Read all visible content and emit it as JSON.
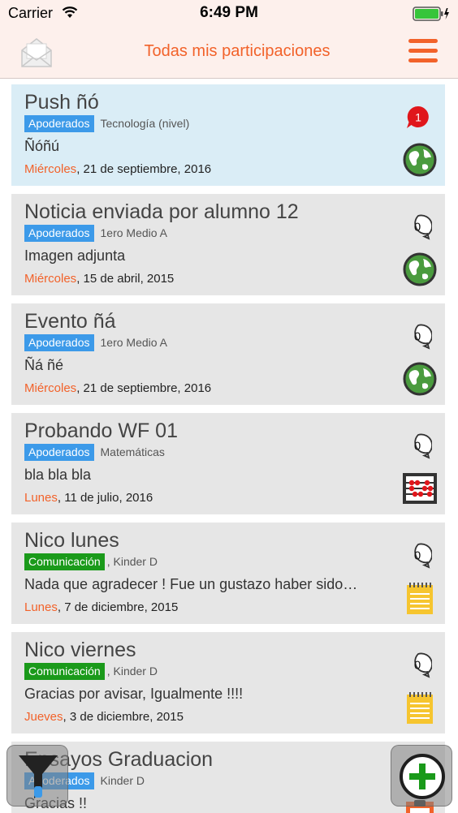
{
  "status_bar": {
    "carrier": "Carrier",
    "time": "6:49 PM"
  },
  "nav": {
    "title": "Todas mis participaciones",
    "left_icon": "envelope-icon",
    "right_icon": "hamburger-menu-icon"
  },
  "colors": {
    "accent": "#f2622a",
    "tag_blue": "#3c9ae9",
    "tag_green": "#1a9a1a",
    "card_bg": "#e6e6e6",
    "card_selected_bg": "#daedf6",
    "badge_red": "#e0161b"
  },
  "items": [
    {
      "title": "Push ñó",
      "tag": "Apoderados",
      "tag_color": "blue",
      "subtitle": "Tecnología (nivel)",
      "text": "Ñóñú",
      "weekday": "Miércoles",
      "date": ", 21 de septiembre, 2016",
      "comments": "1",
      "unread": true,
      "category_icon": "globe-icon",
      "selected": true
    },
    {
      "title": "Noticia enviada por alumno 12",
      "tag": "Apoderados",
      "tag_color": "blue",
      "subtitle": "1ero Medio A",
      "text": "Imagen adjunta",
      "weekday": "Miércoles",
      "date": ", 15 de abril, 2015",
      "comments": "0",
      "unread": false,
      "category_icon": "globe-icon",
      "selected": false
    },
    {
      "title": "Evento ñá",
      "tag": "Apoderados",
      "tag_color": "blue",
      "subtitle": "1ero Medio A",
      "text": "Ñá ñé",
      "weekday": "Miércoles",
      "date": ", 21 de septiembre, 2016",
      "comments": "0",
      "unread": false,
      "category_icon": "globe-icon",
      "selected": false
    },
    {
      "title": "Probando WF 01",
      "tag": "Apoderados",
      "tag_color": "blue",
      "subtitle": "Matemáticas",
      "text": "bla bla bla",
      "weekday": "Lunes",
      "date": ", 11 de julio, 2016",
      "comments": "0",
      "unread": false,
      "category_icon": "abacus-icon",
      "selected": false
    },
    {
      "title": "Nico lunes",
      "tag": "Comunicación",
      "tag_color": "green",
      "subtitle": ", Kinder D",
      "text": "Nada que agradecer ! Fue un gustazo haber sido…",
      "weekday": "Lunes",
      "date": ", 7 de diciembre, 2015",
      "comments": "0",
      "unread": false,
      "category_icon": "notepad-icon",
      "selected": false
    },
    {
      "title": "Nico viernes",
      "tag": "Comunicación",
      "tag_color": "green",
      "subtitle": ", Kinder D",
      "text": "Gracias por avisar, Igualmente !!!!",
      "weekday": "Jueves",
      "date": ", 3 de diciembre, 2015",
      "comments": "0",
      "unread": false,
      "category_icon": "notepad-icon",
      "selected": false
    },
    {
      "title": "Ensayos Graduacion",
      "tag": "Apoderados",
      "tag_color": "blue",
      "subtitle": "Kinder D",
      "text": "Gracias !!",
      "weekday": "",
      "date": "",
      "comments": "",
      "unread": false,
      "category_icon": "clipboard-icon",
      "selected": false
    }
  ],
  "fab": {
    "filter_icon": "filter-funnel-icon",
    "add_icon": "add-plus-icon"
  }
}
